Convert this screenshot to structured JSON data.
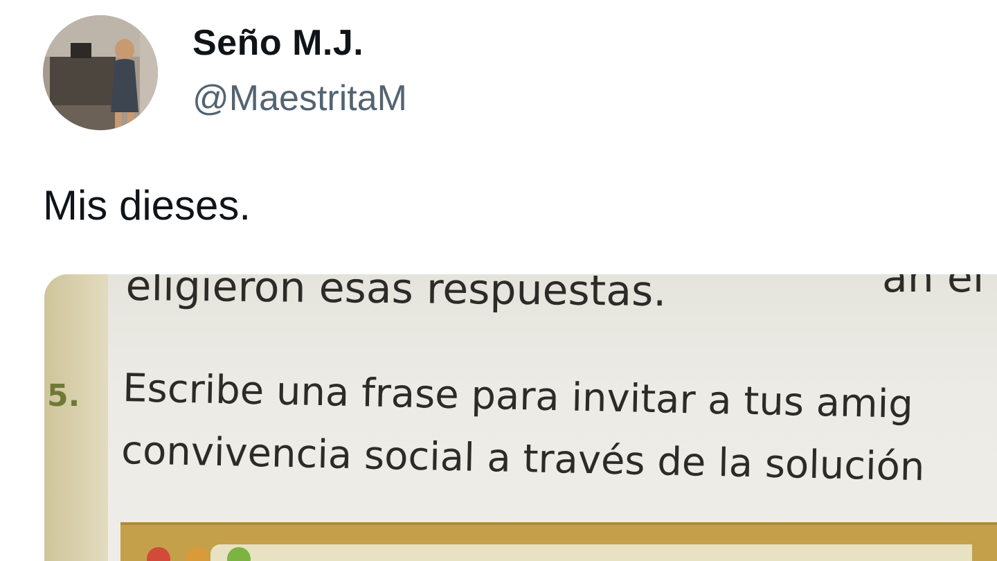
{
  "author": {
    "display_name": "Seño M.J.",
    "handle": "@MaestritaM"
  },
  "tweet": {
    "text": "Mis dieses."
  },
  "media": {
    "line_1": "eligieron esas respuestas.",
    "line_1_cut": "an el",
    "item_number": "5.",
    "line_2": "Escribe una frase para invitar a tus amig",
    "line_3": "convivencia social a través de la solución"
  },
  "colors": {
    "name": "#0f1419",
    "handle": "#536471",
    "item_number": "#6d7a36",
    "answer_band": "#c4a04a"
  }
}
